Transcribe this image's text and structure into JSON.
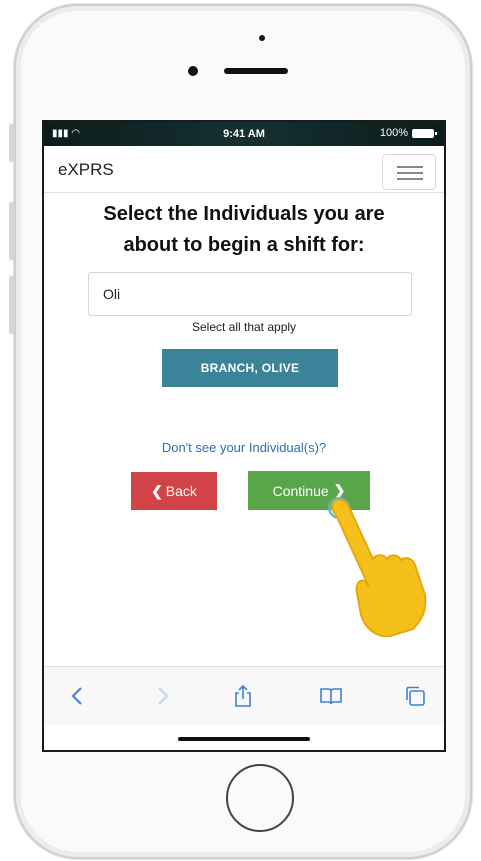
{
  "status_bar": {
    "time": "9:41 AM",
    "battery": "100%"
  },
  "navbar": {
    "brand": "eXPRS",
    "menu_icon": "hamburger-menu-icon"
  },
  "main": {
    "heading_line1": "Select the Individuals you are",
    "heading_line2": "about to begin a shift for:",
    "search_value": "Oli",
    "hint": "Select all that apply",
    "selected_tag": "BRANCH, OLIVE",
    "help_link": "Don't see your Individual(s)?",
    "back_label": "Back",
    "continue_label": "Continue"
  },
  "browser_toolbar": {
    "icons": [
      "back-arrow-icon",
      "forward-arrow-icon",
      "share-icon",
      "bookmarks-icon",
      "tabs-icon"
    ]
  },
  "colors": {
    "tag_bg": "#3a8399",
    "back_bg": "#d24347",
    "continue_bg": "#58a54a",
    "link": "#2f6fb0",
    "toolbar_icon": "#3b82d6",
    "hand": "#f5bf1c"
  }
}
